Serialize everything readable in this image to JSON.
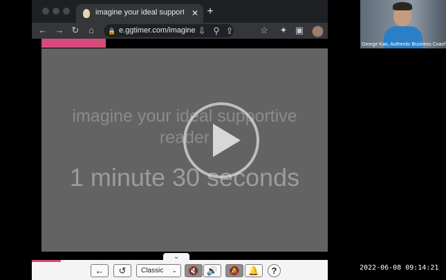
{
  "browser": {
    "tab_title": "imagine your ideal supportive r",
    "close_glyph": "✕",
    "newtab_glyph": "+",
    "url": "e.ggtimer.com/imagine..."
  },
  "icons": {
    "back": "←",
    "forward": "→",
    "reload": "↻",
    "home": "⌂",
    "lock": "🔒",
    "install": "⇩",
    "zoom": "⚲",
    "share": "⇪",
    "star": "☆",
    "extensions": "✦",
    "sidepanel": "▣"
  },
  "video": {
    "subtitle_line1": "imagine your ideal supportive",
    "subtitle_line2": "reader",
    "timer_text": "1 minute 30 seconds"
  },
  "controls": {
    "collapse_glyph": "⌄",
    "back_glyph": "←",
    "restart_glyph": "↺",
    "mode_value": "Classic",
    "caret": "⌄",
    "mute_glyph": "🔇",
    "sound_glyph": "🔊",
    "bell_off_glyph": "🔕",
    "bell_glyph": "🔔",
    "help_glyph": "?"
  },
  "zoom": {
    "participant_name": "George Kao, Authentic Business Coach"
  },
  "timestamp": "2022-06-08 09:14:21",
  "colors": {
    "accent_pink": "#d64b7a",
    "video_gray": "#636363"
  }
}
